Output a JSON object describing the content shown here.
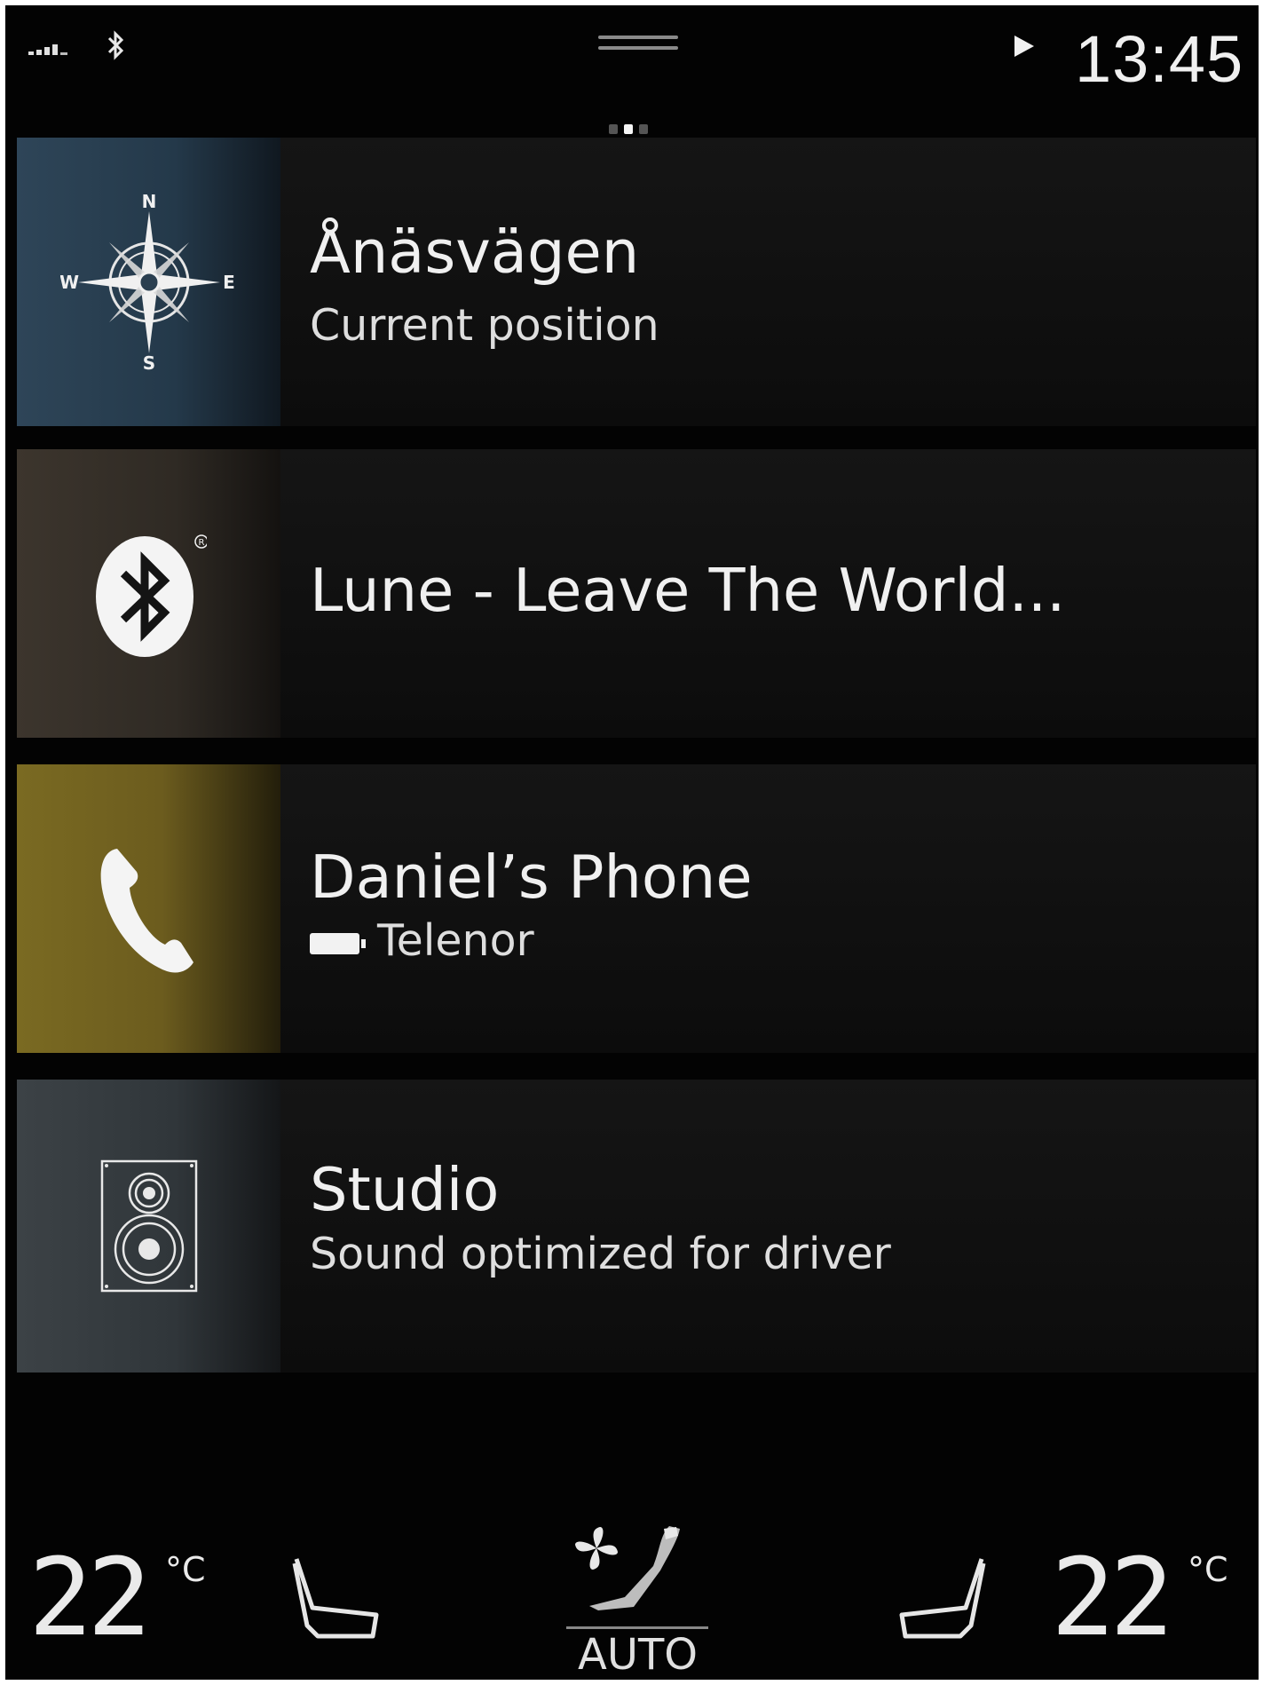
{
  "status": {
    "time": "13:45",
    "icons": [
      "signal-strength-icon",
      "bluetooth-icon",
      "play-icon"
    ]
  },
  "tiles": [
    {
      "id": "navigation",
      "icon": "compass-icon",
      "title": "Ånäsvägen",
      "subtitle": "Current position",
      "compass": {
        "n": "N",
        "e": "E",
        "s": "S",
        "w": "W"
      }
    },
    {
      "id": "media",
      "icon": "bluetooth-icon",
      "title": "Lune - Leave The World...",
      "subtitle": ""
    },
    {
      "id": "phone",
      "icon": "phone-handset-icon",
      "title": "Daniel’s Phone",
      "subtitle": "Telenor"
    },
    {
      "id": "audio",
      "icon": "speaker-icon",
      "title": "Studio",
      "subtitle": "Sound optimized for driver"
    }
  ],
  "climate": {
    "left_temp": "22",
    "right_temp": "22",
    "unit": "°C",
    "fan_label": "AUTO"
  }
}
